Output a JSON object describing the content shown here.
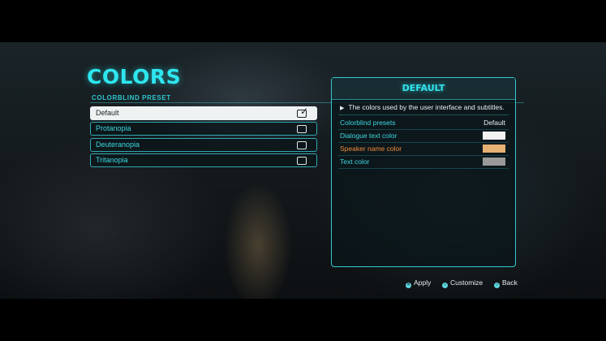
{
  "screen": {
    "title": "COLORS",
    "section_label": "COLORBLIND PRESET"
  },
  "presets": [
    {
      "label": "Default",
      "selected": true
    },
    {
      "label": "Protanopia",
      "selected": false
    },
    {
      "label": "Deuteranopia",
      "selected": false
    },
    {
      "label": "Tritanopia",
      "selected": false
    }
  ],
  "panel": {
    "title": "DEFAULT",
    "description": "The colors used by the user interface and subtitles.",
    "rows": [
      {
        "label": "Colorblind presets",
        "value": "Default"
      },
      {
        "label": "Dialogue text color",
        "swatch": "#f2f2f2"
      },
      {
        "label": "Speaker name color",
        "swatch": "#e8b174",
        "highlight": true
      },
      {
        "label": "Text color",
        "swatch": "#9a9a9a"
      }
    ]
  },
  "footer": {
    "apply": "Apply",
    "customize": "Customize",
    "back": "Back"
  },
  "colors": {
    "accent": "#2ee6ef",
    "highlight": "#f08a3c"
  }
}
